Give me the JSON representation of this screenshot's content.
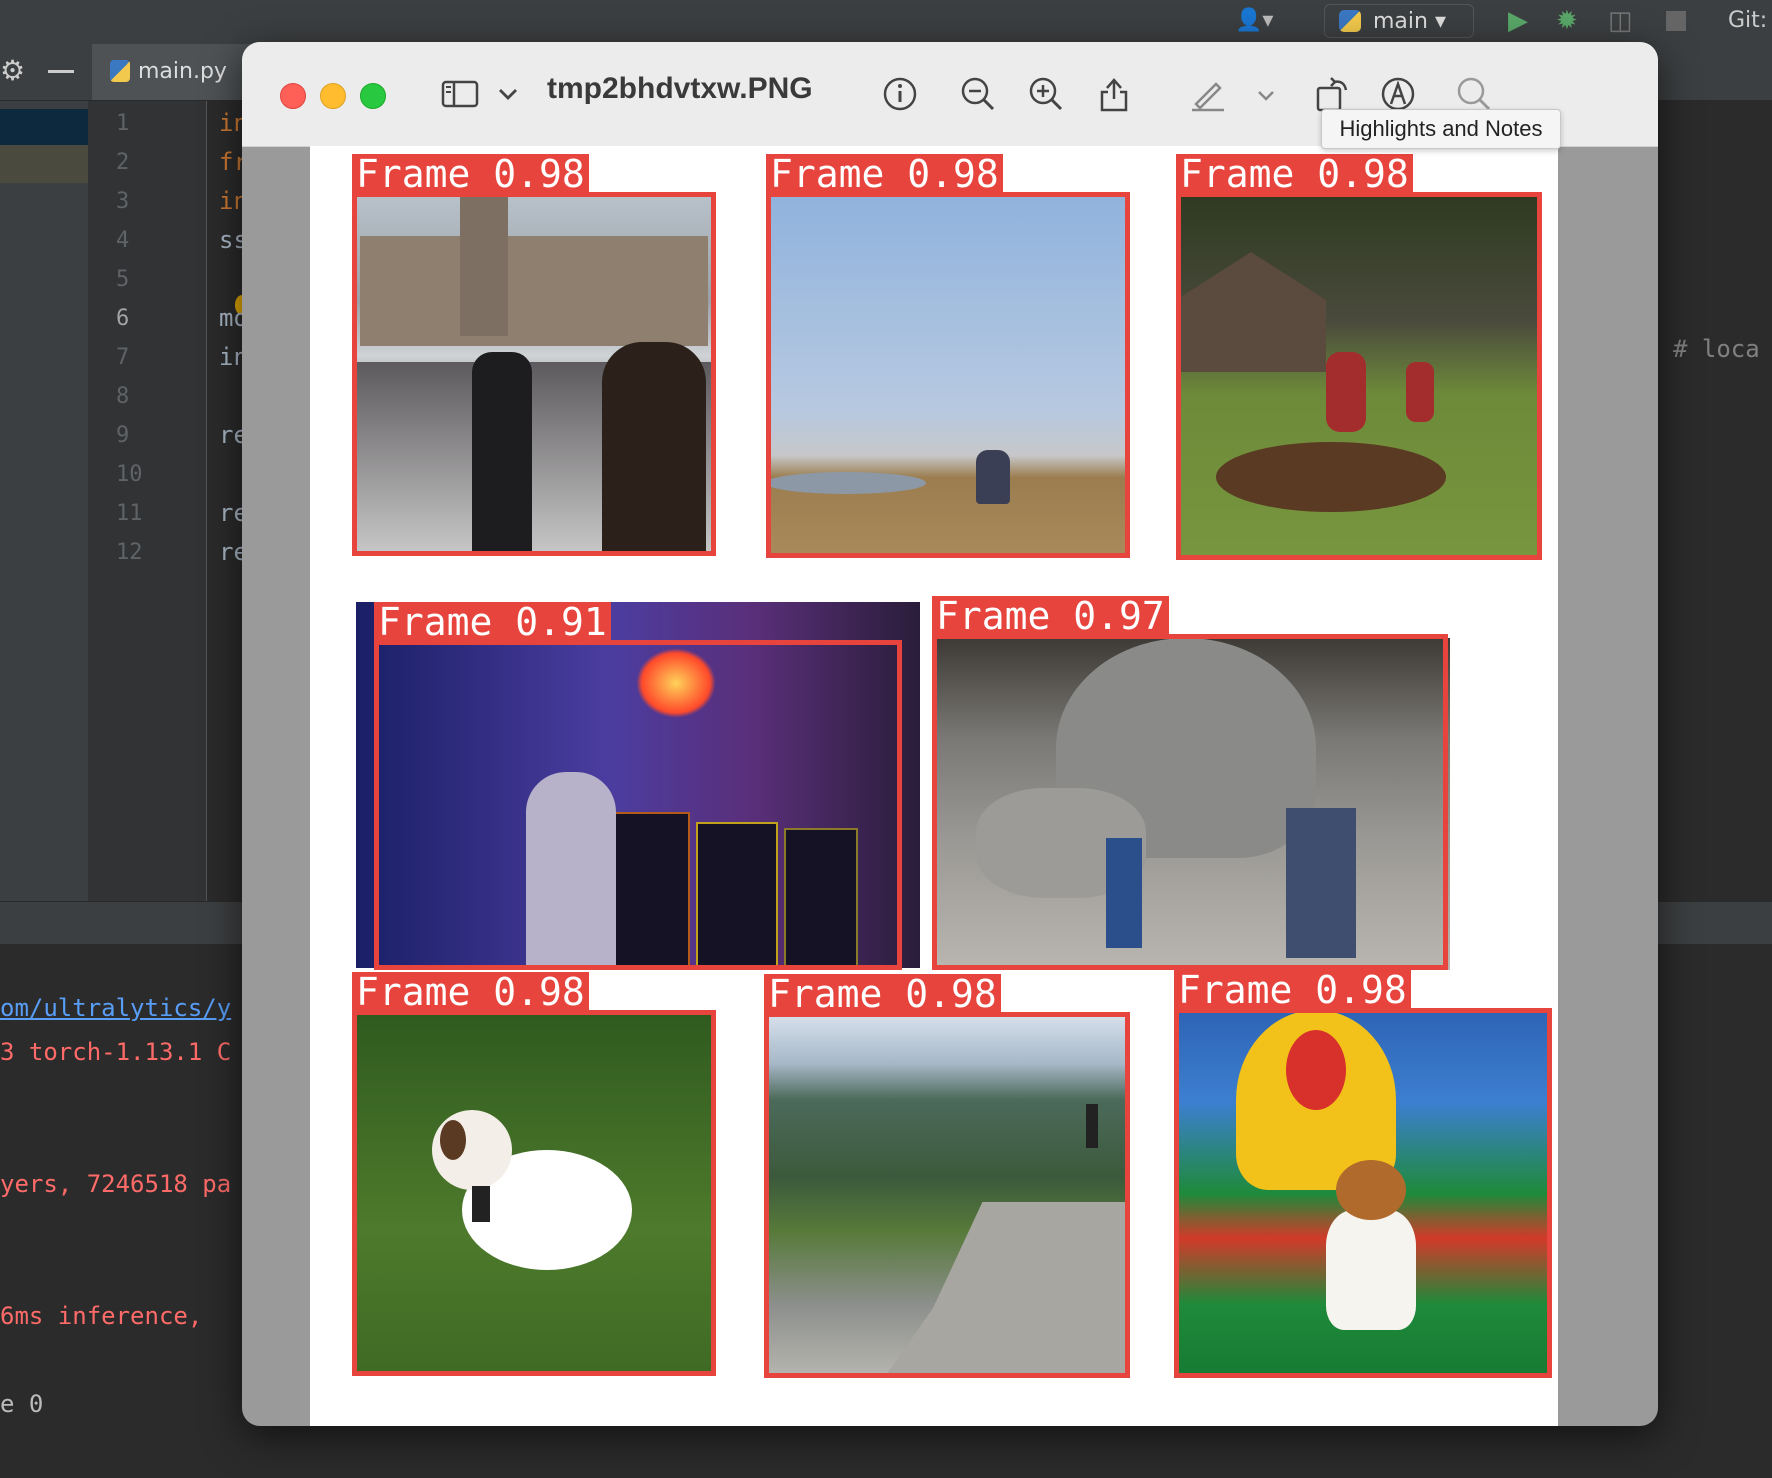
{
  "ide": {
    "branch": "main",
    "git": "Git:",
    "file_tab": "main.py",
    "line_numbers": [
      "1",
      "2",
      "3",
      "4",
      "5",
      "6",
      "7",
      "8",
      "9",
      "10",
      "11",
      "12"
    ],
    "code_fragments": [
      "in",
      "fr",
      "in",
      "ss",
      "mo",
      "in",
      "re",
      "re",
      "re"
    ],
    "comment_fragment": "# loca",
    "console": [
      "om/ultralytics/y",
      "3 torch-1.13.1 C",
      "yers, 7246518 pa",
      "6ms inference,",
      "e 0"
    ]
  },
  "preview": {
    "title": "tmp2bhdvtxw.PNG",
    "tooltip": "Highlights and Notes",
    "toolbar_icons": [
      "sidebar-toggle-icon",
      "chevron-down-icon",
      "info-icon",
      "zoom-out-icon",
      "zoom-in-icon",
      "share-icon",
      "highlight-pen-icon",
      "markup-chevron-icon",
      "rotate-icon",
      "markup-icon",
      "search-icon"
    ],
    "detections": [
      {
        "label": "Frame 0.98",
        "scene": "parliament-winter-crowd"
      },
      {
        "label": "Frame 0.98",
        "scene": "lake-shore-person"
      },
      {
        "label": "Frame 0.98",
        "scene": "kids-leaf-pile"
      },
      {
        "label": "Frame 0.91",
        "scene": "arcade-neon"
      },
      {
        "label": "Frame 0.97",
        "scene": "troll-sculpture"
      },
      {
        "label": "Frame 0.98",
        "scene": "running-dog"
      },
      {
        "label": "Frame 0.98",
        "scene": "mountain-vista"
      },
      {
        "label": "Frame 0.98",
        "scene": "bouncy-castle-child"
      }
    ]
  }
}
